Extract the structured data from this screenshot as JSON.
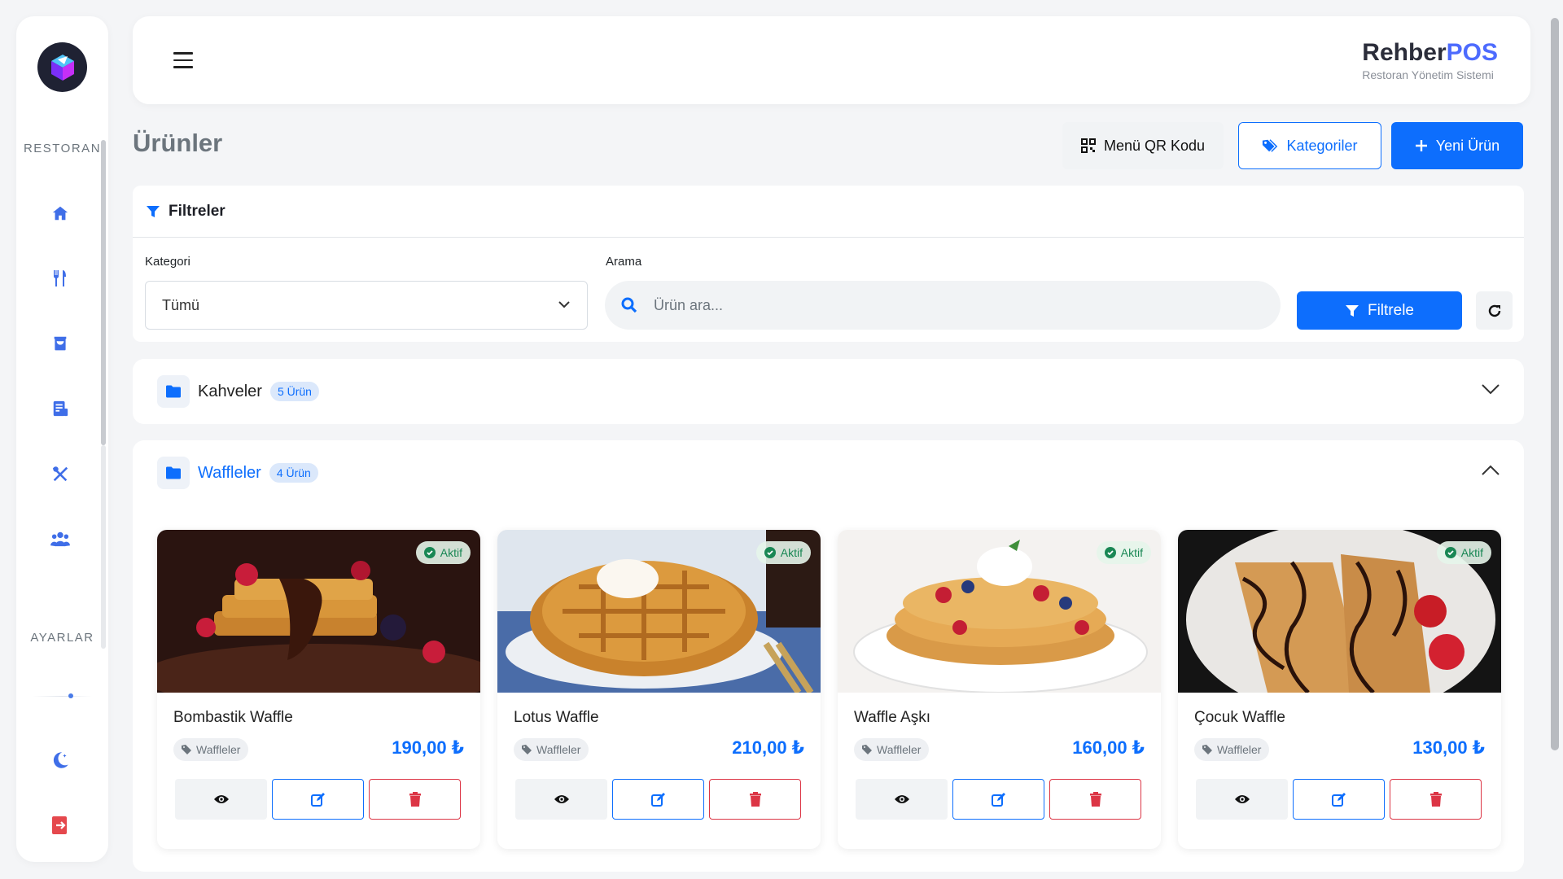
{
  "sidebar": {
    "section_restaurant": "RESTORAN",
    "section_settings": "AYARLAR",
    "items": [
      {
        "icon": "home-icon"
      },
      {
        "icon": "utensils-icon"
      },
      {
        "icon": "shopping-bag-icon"
      },
      {
        "icon": "receipt-icon"
      },
      {
        "icon": "fork-knife-crossed-icon"
      },
      {
        "icon": "users-icon"
      }
    ],
    "bottom": [
      {
        "icon": "moon-icon"
      },
      {
        "icon": "logout-icon"
      }
    ]
  },
  "header": {
    "brand_main": "Rehber",
    "brand_accent": "POS",
    "brand_subtitle": "Restoran Yönetim Sistemi"
  },
  "page": {
    "title": "Ürünler",
    "qr_button": "Menü QR Kodu",
    "categories_button": "Kategoriler",
    "new_product_button": "Yeni Ürün"
  },
  "filters": {
    "title": "Filtreler",
    "category_label": "Kategori",
    "category_value": "Tümü",
    "search_label": "Arama",
    "search_placeholder": "Ürün ara...",
    "filter_button": "Filtrele"
  },
  "categories": [
    {
      "name": "Kahveler",
      "count": "5 Ürün",
      "expanded": false
    },
    {
      "name": "Waffleler",
      "count": "4 Ürün",
      "expanded": true
    }
  ],
  "products": [
    {
      "name": "Bombastik Waffle",
      "category": "Waffleler",
      "price": "190,00 ₺",
      "status": "Aktif"
    },
    {
      "name": "Lotus Waffle",
      "category": "Waffleler",
      "price": "210,00 ₺",
      "status": "Aktif"
    },
    {
      "name": "Waffle Aşkı",
      "category": "Waffleler",
      "price": "160,00 ₺",
      "status": "Aktif"
    },
    {
      "name": "Çocuk Waffle",
      "category": "Waffleler",
      "price": "130,00 ₺",
      "status": "Aktif"
    }
  ],
  "colors": {
    "primary": "#0d6efd",
    "danger": "#dc3545",
    "success": "#198754",
    "brand_accent": "#4d6bfe"
  }
}
